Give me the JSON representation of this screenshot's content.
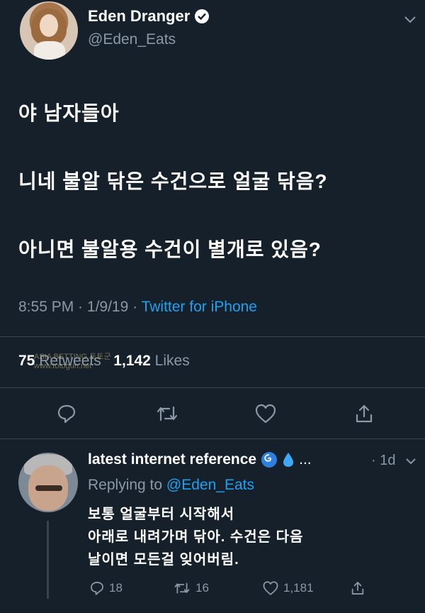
{
  "tweet": {
    "author_name": "Eden Dranger",
    "handle": "@Eden_Eats",
    "lines": [
      "야 남자들아",
      "니네 불알 닦은 수건으로 얼굴 닦음?",
      "아니면 불알용 수건이 별개로 있음?"
    ],
    "time": "8:55 PM",
    "date": "1/9/19",
    "separator": " · ",
    "source": "Twitter for iPhone",
    "retweets_count": "75",
    "retweets_label": "Retweets",
    "likes_count": "1,142",
    "likes_label": "Likes",
    "watermark_line1": "ASIA BETTING 토토군",
    "watermark_line2": "www.totogun.net"
  },
  "reply": {
    "author_name": "latest internet reference",
    "ellipsis": "...",
    "time": "· 1d",
    "replying_prefix": "Replying to",
    "replying_handle": "@Eden_Eats",
    "lines": [
      "보통 얼굴부터 시작해서",
      "아래로 내려가며 닦아. 수건은 다음",
      "날이면 모든걸 잊어버림."
    ],
    "replies": "18",
    "retweets": "16",
    "likes": "1,181"
  },
  "colors": {
    "background": "#15202b",
    "accent": "#1da1f2",
    "muted": "#8b98a5",
    "divider": "#38444d"
  }
}
